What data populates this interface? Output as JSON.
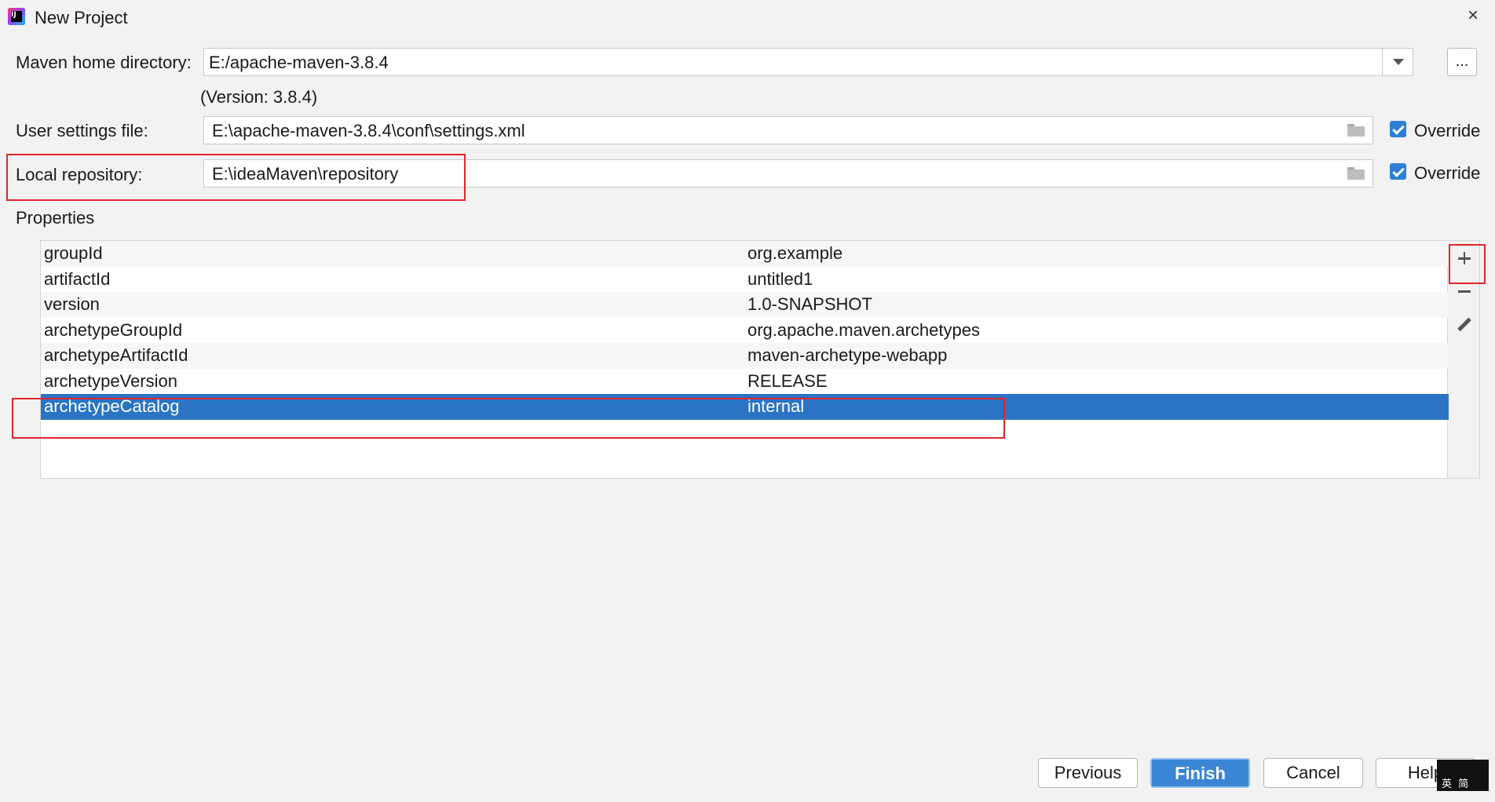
{
  "window": {
    "title": "New Project",
    "close_glyph": "×"
  },
  "maven_home": {
    "label": "Maven home directory:",
    "value": "E:/apache-maven-3.8.4",
    "browse_label": "...",
    "version_text": "(Version: 3.8.4)"
  },
  "user_settings": {
    "label": "User settings file:",
    "value": "E:\\apache-maven-3.8.4\\conf\\settings.xml",
    "override_label": "Override",
    "override_checked": true
  },
  "local_repo": {
    "label": "Local repository:",
    "value": "E:\\ideaMaven\\repository",
    "override_label": "Override",
    "override_checked": true
  },
  "properties": {
    "label": "Properties",
    "rows": [
      {
        "key": "groupId",
        "value": "org.example"
      },
      {
        "key": "artifactId",
        "value": "untitled1"
      },
      {
        "key": "version",
        "value": "1.0-SNAPSHOT"
      },
      {
        "key": "archetypeGroupId",
        "value": "org.apache.maven.archetypes"
      },
      {
        "key": "archetypeArtifactId",
        "value": "maven-archetype-webapp"
      },
      {
        "key": "archetypeVersion",
        "value": "RELEASE"
      },
      {
        "key": "archetypeCatalog",
        "value": "internal"
      }
    ],
    "selected_index": 6,
    "toolbar": [
      "plus-icon",
      "minus-icon",
      "pencil-icon"
    ]
  },
  "buttons": {
    "previous": "Previous",
    "finish": "Finish",
    "cancel": "Cancel",
    "help": "Help"
  },
  "ime": {
    "text": "英 简"
  },
  "colors": {
    "selection": "#2b74c4",
    "highlight_box": "#e0242a",
    "checkbox": "#2d7fd6",
    "primary_button": "#3a86d4"
  }
}
